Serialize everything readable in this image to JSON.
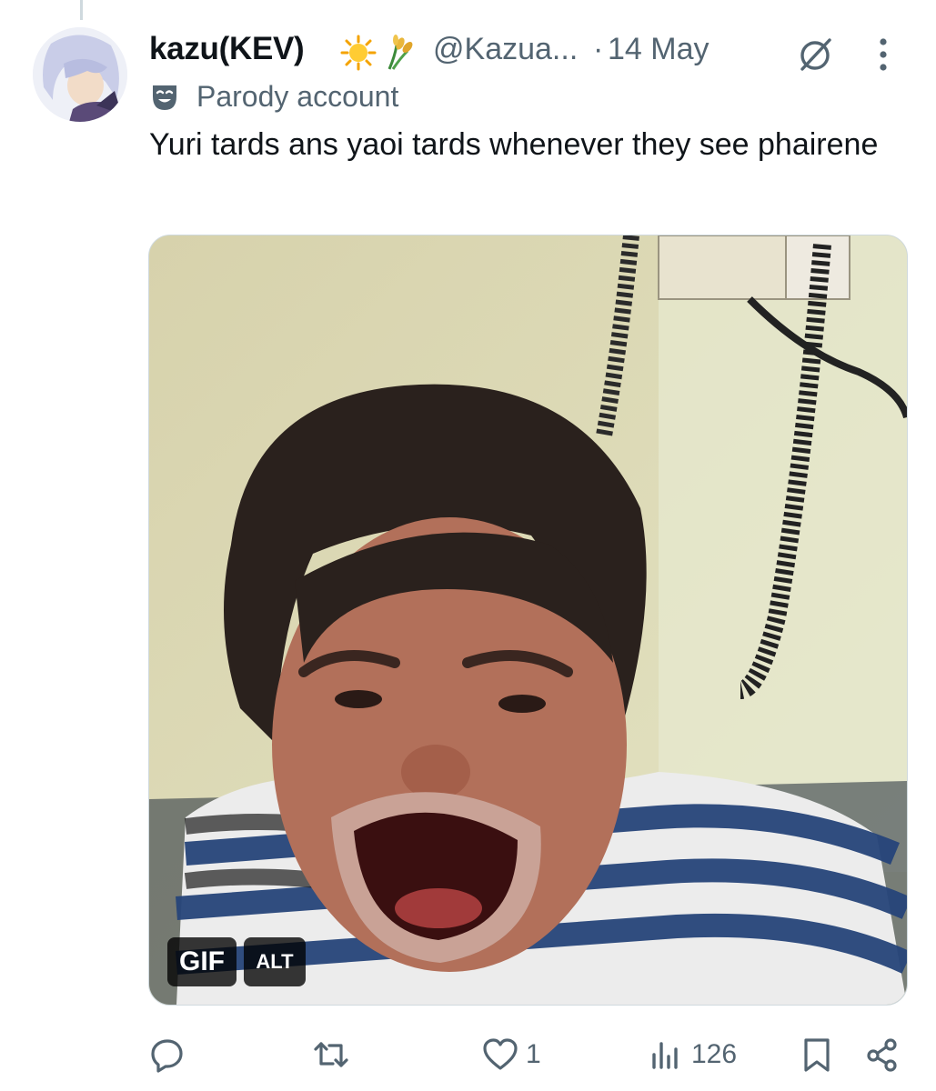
{
  "author": {
    "display_name": "kazu(KEV)",
    "emojis": [
      "sun-emoji",
      "rice-sheaf-emoji"
    ],
    "handle": "@Kazua...",
    "separator": "·",
    "date": "14 May",
    "label_icon": "theater-mask-icon",
    "label": "Parody account"
  },
  "tweet": {
    "text": "Yuri tards ans yaoi tards whenever they see phairene"
  },
  "media": {
    "type_badge": "GIF",
    "alt_badge": "ALT"
  },
  "actions": {
    "reply": {
      "icon": "reply-icon",
      "count": ""
    },
    "repost": {
      "icon": "repost-icon",
      "count": ""
    },
    "like": {
      "icon": "heart-icon",
      "count": "1"
    },
    "views": {
      "icon": "views-icon",
      "count": "126"
    },
    "bookmark": {
      "icon": "bookmark-icon"
    },
    "share": {
      "icon": "share-icon"
    }
  },
  "colors": {
    "text_primary": "#0f1419",
    "text_secondary": "#536471",
    "border": "#cfd9de"
  }
}
